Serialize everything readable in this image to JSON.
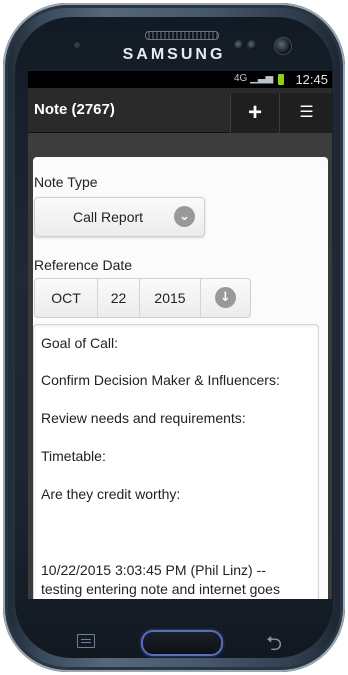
{
  "device": {
    "brand": "SAMSUNG"
  },
  "status_bar": {
    "time": "12:45",
    "network": "4G",
    "signal": "▁▃▅",
    "battery_color": "#8ed11b"
  },
  "app_bar": {
    "title": "Note (2767)",
    "add_icon": "plus-icon",
    "menu_icon": "list-icon",
    "add_glyph": "+",
    "menu_glyph": "☰"
  },
  "form": {
    "note_type_label": "Note Type",
    "note_type_value": "Call Report",
    "reference_date_label": "Reference Date",
    "date_month": "OCT",
    "date_day": "22",
    "date_year": "2015",
    "note_lines": [
      "Goal of Call:",
      "Confirm Decision Maker & Influencers:",
      "Review needs and requirements:",
      "Timetable:",
      "Are they credit worthy:",
      "10/22/2015 3:03:45 PM (Phil Linz) --",
      "testing entering note and internet goes"
    ]
  },
  "icons": {
    "select_chevron": "chevron-down-icon",
    "date_picker": "arrow-down-circle-icon"
  },
  "hardware_keys": {
    "back_glyph": "⮌"
  }
}
